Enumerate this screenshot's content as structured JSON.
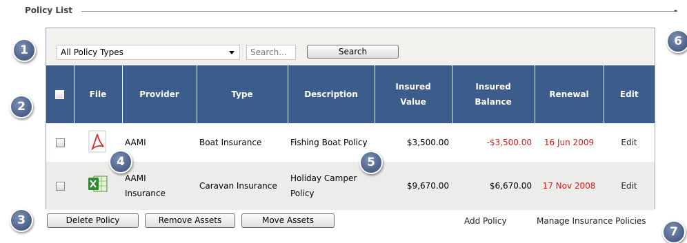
{
  "section": {
    "title": "Policy List",
    "collapse_label": "-"
  },
  "filters": {
    "policy_type_selected": "All Policy Types",
    "search_placeholder": "Search...",
    "search_button": "Search"
  },
  "table": {
    "headers": {
      "file": "File",
      "provider": "Provider",
      "type": "Type",
      "description": "Description",
      "insured_value_1": "Insured",
      "insured_value_2": "Value",
      "insured_balance_1": "Insured",
      "insured_balance_2": "Balance",
      "renewal": "Renewal",
      "edit": "Edit"
    },
    "rows": [
      {
        "file_icon": "pdf-icon",
        "provider": "AAMI",
        "type": "Boat Insurance",
        "description": "Fishing Boat Policy",
        "insured_value": "$3,500.00",
        "insured_balance": "-$3,500.00",
        "renewal": "16 Jun 2009",
        "edit": "Edit"
      },
      {
        "file_icon": "excel-icon",
        "provider_line1": "AAMI",
        "provider_line2": "Insurance",
        "type": "Caravan Insurance",
        "description_line1": "Holiday Camper",
        "description_line2": "Policy",
        "insured_value": "$9,670.00",
        "insured_balance": "$6,670.00",
        "renewal": "17 Nov 2008",
        "edit": "Edit"
      }
    ]
  },
  "footer": {
    "delete_policy": "Delete Policy",
    "remove_assets": "Remove Assets",
    "move_assets": "Move Assets",
    "add_policy": "Add Policy",
    "manage_policies": "Manage Insurance Policies"
  },
  "callouts": [
    "1",
    "2",
    "3",
    "4",
    "5",
    "6",
    "7"
  ],
  "colors": {
    "header_bg": "#3c5c8c",
    "negative_red": "#e01818",
    "badge_blue": "#4b5f88",
    "panel_bg": "#f2f1ee"
  }
}
